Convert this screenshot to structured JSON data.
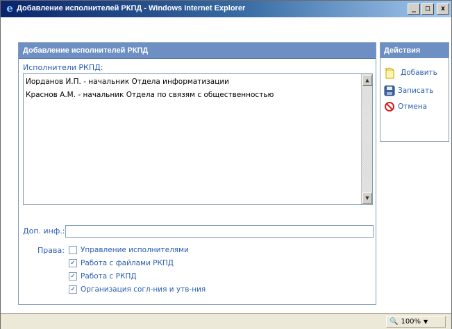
{
  "window": {
    "title": "Добавление исполнителей РКПД - Windows Internet Explorer",
    "controls": {
      "minimize": "_",
      "maximize": "□",
      "close": "x"
    }
  },
  "form": {
    "header": "Добавление исполнителей РКПД",
    "executors_label": "Исполнители РКПД:",
    "executors": [
      "Иорданов И.П. - начальник Отдела информатизации",
      "Краснов А.М. - начальник Отдела по связям с общественностью"
    ],
    "extra_label": "Доп. инф.:",
    "extra_value": "",
    "rights_label": "Права:",
    "rights": [
      {
        "label": "Управление исполнителями",
        "checked": false
      },
      {
        "label": "Работа с файлами РКПД",
        "checked": true
      },
      {
        "label": "Работа с РКПД",
        "checked": true
      },
      {
        "label": "Организация согл-ния и утв-ния",
        "checked": true
      }
    ]
  },
  "actions": {
    "header": "Действия",
    "add": "Добавить",
    "save": "Записать",
    "cancel": "Отмена"
  },
  "status": {
    "zoom": "100%"
  },
  "colors": {
    "header_bg": "#6d8fc4",
    "label_text": "#2a5db0",
    "titlebar": "#0a246a"
  }
}
